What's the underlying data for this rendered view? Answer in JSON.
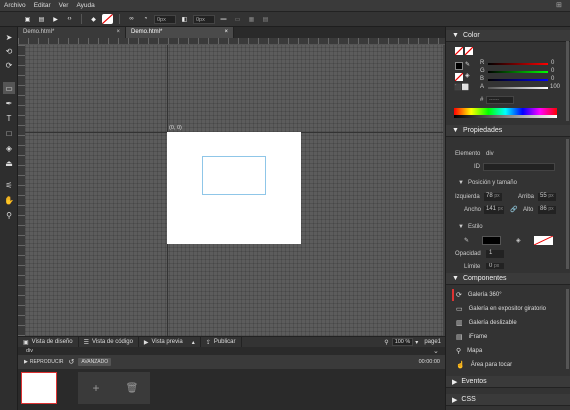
{
  "menu": [
    "Archivo",
    "Editar",
    "Ver",
    "Ayuda"
  ],
  "toolbar": {
    "field1": "0px",
    "field2": "0px",
    "icons": [
      "image-icon",
      "picture-icon",
      "video-icon",
      "code-icon",
      "fill-icon",
      "no-fill-icon",
      "link-icon",
      "radius-icon",
      "shadow-icon",
      "text-icon",
      "align-icon",
      "grid-icon",
      "more-icon"
    ]
  },
  "tabs": [
    {
      "label": "Demo.html*",
      "close": "×"
    },
    {
      "label": "Demo.html*",
      "close": "×"
    }
  ],
  "canvas": {
    "coord": "(0, 0)"
  },
  "viewbar": {
    "design": "Vista de diseño",
    "code": "Vista de código",
    "preview": "Vista previa",
    "publish": "Publicar",
    "zoom": "100",
    "zoom_unit": "%",
    "page": "page1"
  },
  "timeline": {
    "element": "div",
    "play": "REPRODUCIR",
    "advanced": "AVANZADO",
    "time": "00:00:00"
  },
  "color": {
    "title": "Color",
    "r_label": "R",
    "r_value": "0",
    "g_label": "G",
    "g_value": "0",
    "b_label": "B",
    "b_value": "0",
    "a_label": "A",
    "a_value": "100",
    "hash": "#",
    "hex": "------"
  },
  "props": {
    "title": "Propiedades",
    "element_label": "Elemento",
    "element_value": "div",
    "id_label": "ID",
    "pos_title": "Posición y tamaño",
    "left_label": "Izquierda",
    "left_value": "78",
    "top_label": "Arriba",
    "top_value": "55",
    "width_label": "Ancho",
    "width_value": "141",
    "height_label": "Alto",
    "height_value": "86",
    "unit": "px",
    "style_title": "Estilo",
    "opacity_label": "Opacidad",
    "opacity_value": "1",
    "border_label": "Límite",
    "border_value": "0",
    "border_unit": "px"
  },
  "components": {
    "title": "Componentes",
    "items": [
      "Galería 360°",
      "Galería en expositor giratorio",
      "Galería deslizable",
      "iFrame",
      "Mapa",
      "Área para tocar"
    ]
  },
  "events": {
    "title": "Eventos"
  },
  "css": {
    "title": "CSS"
  }
}
